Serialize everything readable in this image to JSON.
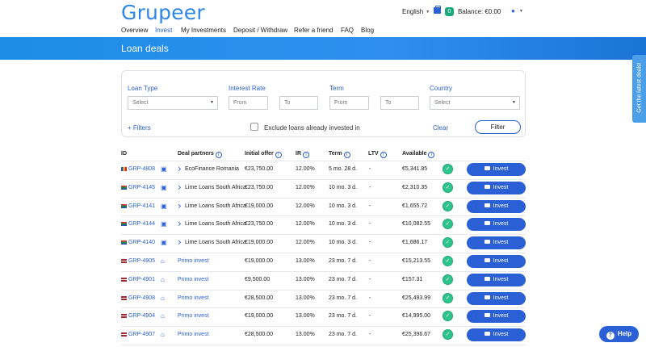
{
  "header": {
    "logo": "Grupeer",
    "language": "English",
    "wallet_count": "0",
    "balance": "Balance: €0.00"
  },
  "nav": [
    {
      "label": "Overview",
      "active": false
    },
    {
      "label": "Invest",
      "active": true
    },
    {
      "label": "My Investments",
      "active": false
    },
    {
      "label": "Deposit / Withdraw",
      "active": false
    },
    {
      "label": "Refer a friend",
      "active": false
    },
    {
      "label": "FAQ",
      "active": false
    },
    {
      "label": "Blog",
      "active": false
    }
  ],
  "hero": {
    "title": "Loan deals"
  },
  "side_tab": {
    "label": "Get the latest deals!"
  },
  "filters": {
    "loan_type_label": "Loan Type",
    "loan_type_value": "Select",
    "interest_rate_label": "Interest Rate",
    "interest_from": "From",
    "interest_to": "To",
    "term_label": "Term",
    "term_from": "From",
    "term_to": "To",
    "country_label": "Country",
    "country_value": "Select",
    "more_filters": "+ Filters",
    "exclude_label": "Exclude loans already invested in",
    "clear_label": "Clear",
    "filter_button": "Filter"
  },
  "table": {
    "headers": {
      "id": "ID",
      "deal_partners": "Deal partners",
      "initial_offer": "Initial offer",
      "ir": "IR",
      "term": "Term",
      "ltv": "LTV",
      "available": "Available"
    },
    "invest_label": "Invest",
    "rows": [
      {
        "id": "GRP-4808",
        "partner": "EcoFinance Romania",
        "offer": "€23,750.00",
        "ir": "12.00%",
        "term": "5 mo. 28 d.",
        "ltv": "-",
        "available": "€5,341.85",
        "flag": "ro",
        "kind": "briefcase"
      },
      {
        "id": "GRP-4145",
        "partner": "Lime Loans South Africa",
        "offer": "€23,750.00",
        "ir": "12.00%",
        "term": "10 mo. 3 d.",
        "ltv": "-",
        "available": "€2,310.35",
        "flag": "za",
        "kind": "briefcase"
      },
      {
        "id": "GRP-4141",
        "partner": "Lime Loans South Africa",
        "offer": "€19,000.00",
        "ir": "12.00%",
        "term": "10 mo. 3 d.",
        "ltv": "-",
        "available": "€1,655.72",
        "flag": "za",
        "kind": "briefcase"
      },
      {
        "id": "GRP-4144",
        "partner": "Lime Loans South Africa",
        "offer": "€23,750.00",
        "ir": "12.00%",
        "term": "10 mo. 3 d.",
        "ltv": "-",
        "available": "€10,082.55",
        "flag": "za",
        "kind": "briefcase"
      },
      {
        "id": "GRP-4140",
        "partner": "Lime Loans South Africa",
        "offer": "€19,000.00",
        "ir": "12.00%",
        "term": "10 mo. 3 d.",
        "ltv": "-",
        "available": "€1,686.17",
        "flag": "za",
        "kind": "briefcase"
      },
      {
        "id": "GRP-4905",
        "partner": "Primo invest",
        "offer": "€19,000.00",
        "ir": "13.00%",
        "term": "23 mo. 7 d.",
        "ltv": "-",
        "available": "€15,213.55",
        "flag": "lv",
        "kind": "home"
      },
      {
        "id": "GRP-4901",
        "partner": "Primo invest",
        "offer": "€9,500.00",
        "ir": "13.00%",
        "term": "23 mo. 7 d.",
        "ltv": "-",
        "available": "€157.31",
        "flag": "lv",
        "kind": "home"
      },
      {
        "id": "GRP-4908",
        "partner": "Primo invest",
        "offer": "€28,500.00",
        "ir": "13.00%",
        "term": "23 mo. 7 d.",
        "ltv": "-",
        "available": "€25,493.99",
        "flag": "lv",
        "kind": "home"
      },
      {
        "id": "GRP-4904",
        "partner": "Primo invest",
        "offer": "€19,000.00",
        "ir": "13.00%",
        "term": "23 mo. 7 d.",
        "ltv": "-",
        "available": "€14,995.00",
        "flag": "lv",
        "kind": "home"
      },
      {
        "id": "GRP-4907",
        "partner": "Primo invest",
        "offer": "€28,500.00",
        "ir": "13.00%",
        "term": "23 mo. 7 d.",
        "ltv": "-",
        "available": "€25,396.67",
        "flag": "lv",
        "kind": "home"
      }
    ]
  },
  "help_button": "Help",
  "colors": {
    "accent": "#2a5fd6",
    "brand": "#2f87e8",
    "success": "#2fc48d"
  }
}
